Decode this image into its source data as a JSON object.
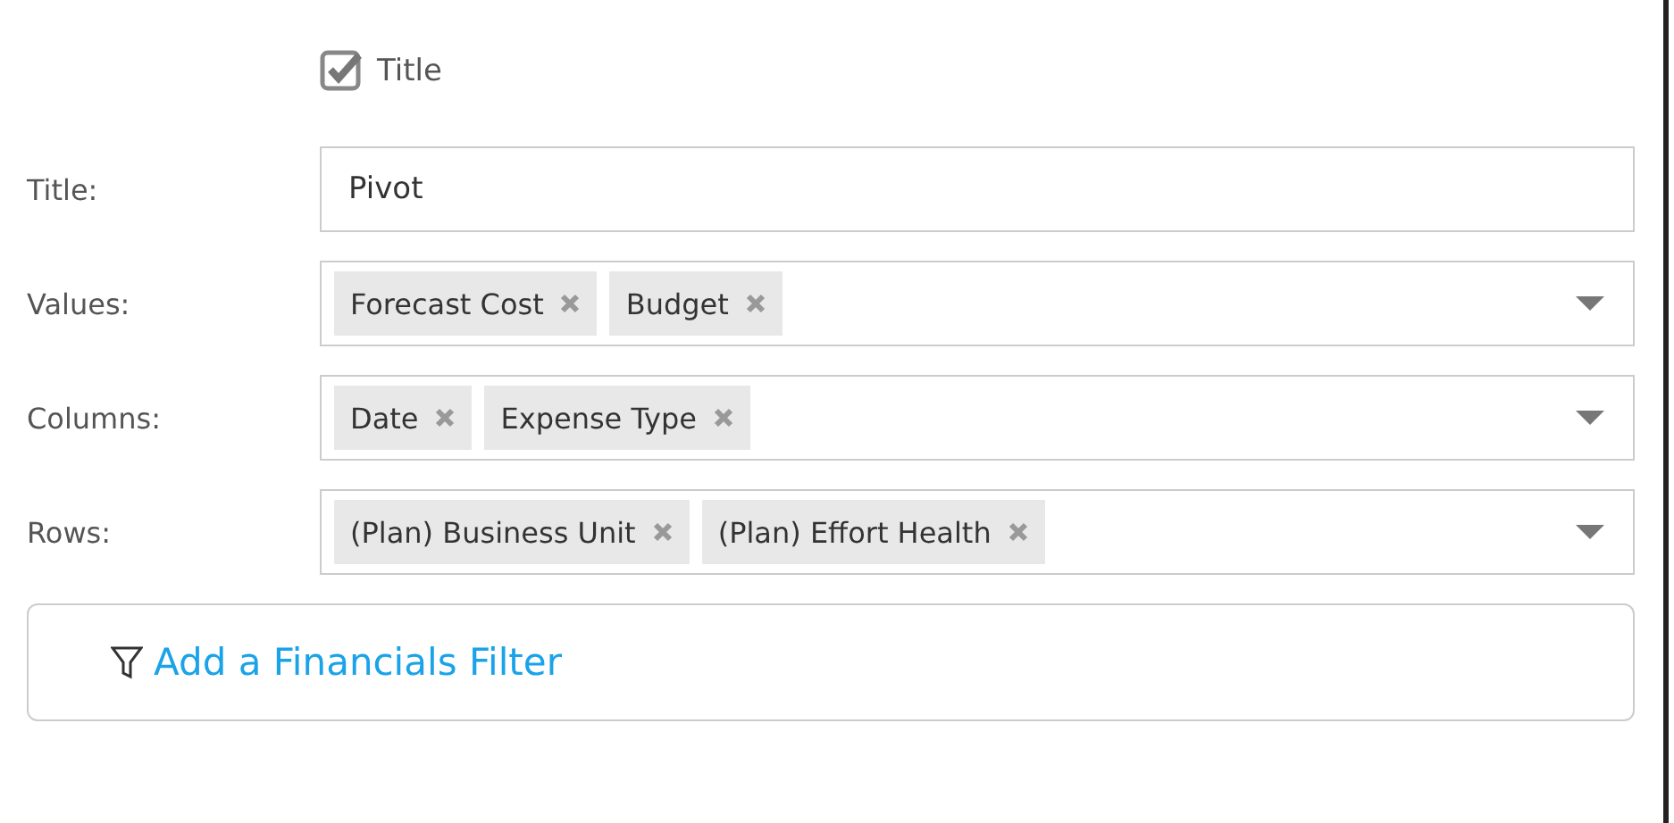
{
  "show_title": {
    "label": "Title",
    "checked": true
  },
  "title_field": {
    "label": "Title:",
    "value": "Pivot"
  },
  "selectors": [
    {
      "label": "Values:",
      "tags": [
        "Forecast Cost",
        "Budget"
      ]
    },
    {
      "label": "Columns:",
      "tags": [
        "Date",
        "Expense Type"
      ]
    },
    {
      "label": "Rows:",
      "tags": [
        "(Plan) Business Unit",
        "(Plan) Effort Health"
      ]
    }
  ],
  "filter_link": "Add a Financials Filter"
}
